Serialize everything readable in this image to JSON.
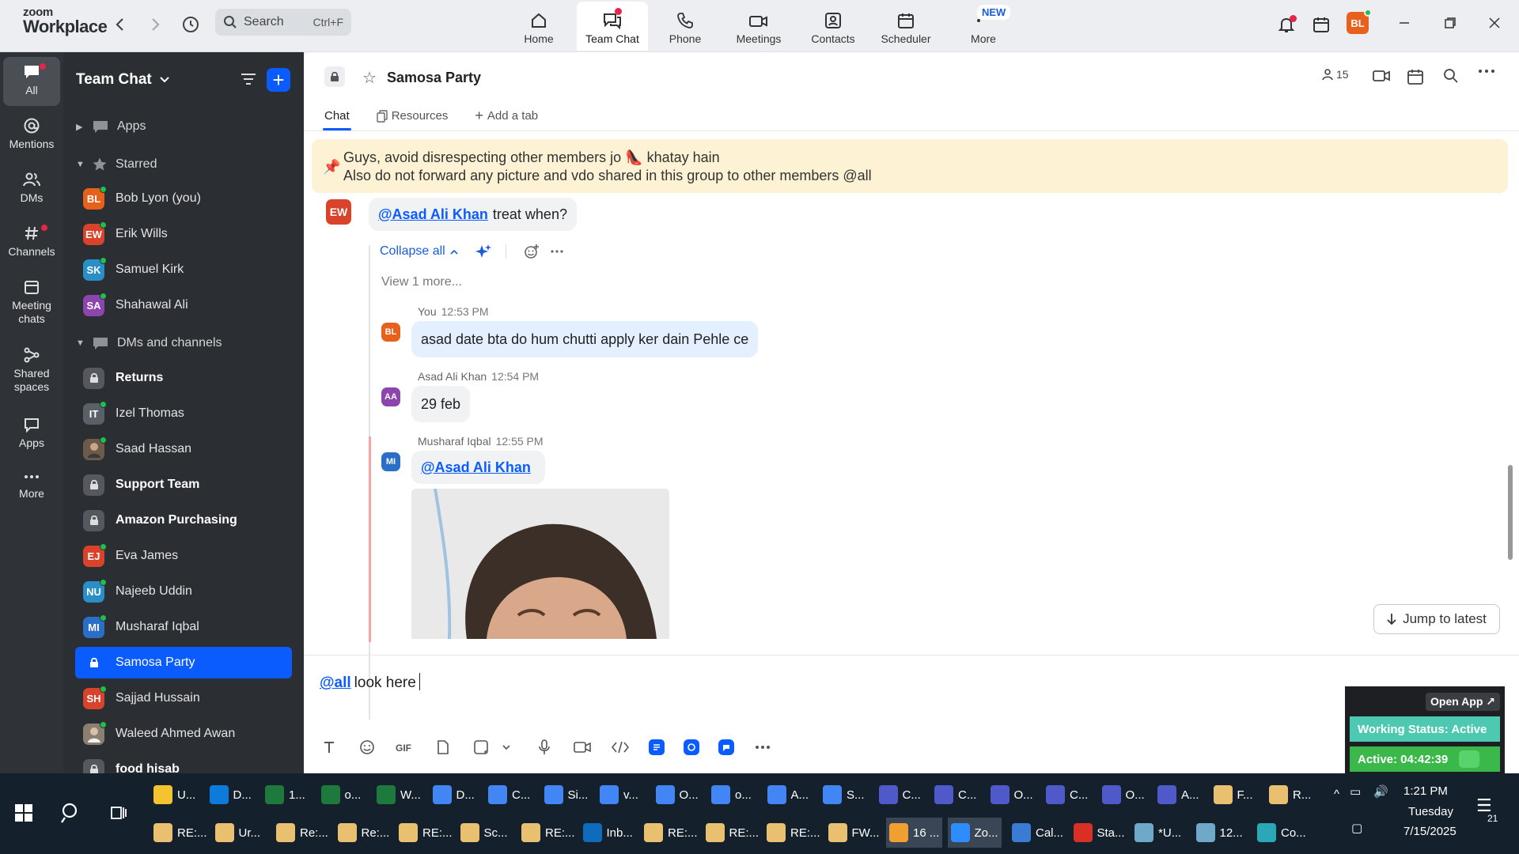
{
  "app": {
    "logo_line1": "zoom",
    "logo_line2": "Workplace",
    "search_placeholder": "Search",
    "search_shortcut": "Ctrl+F",
    "new_badge": "NEW",
    "user_initials": "BL",
    "accent": "#0b5cff"
  },
  "top_tabs": [
    {
      "label": "Home",
      "icon": "home-icon"
    },
    {
      "label": "Team Chat",
      "icon": "chat-icon",
      "active": true
    },
    {
      "label": "Phone",
      "icon": "phone-icon"
    },
    {
      "label": "Meetings",
      "icon": "video-icon"
    },
    {
      "label": "Contacts",
      "icon": "contacts-icon"
    },
    {
      "label": "Scheduler",
      "icon": "calendar-icon"
    },
    {
      "label": "More",
      "icon": "more-icon"
    }
  ],
  "rail": [
    {
      "label": "All",
      "icon": "chat-bubble-icon",
      "active": true
    },
    {
      "label": "Mentions",
      "icon": "at-icon"
    },
    {
      "label": "DMs",
      "icon": "people-icon"
    },
    {
      "label": "Channels",
      "icon": "hash-icon"
    },
    {
      "label": "Meeting chats",
      "icon": "calendar-icon"
    },
    {
      "label": "Shared spaces",
      "icon": "shared-icon"
    },
    {
      "label": "Apps",
      "icon": "apps-icon"
    },
    {
      "label": "More",
      "icon": "more-icon"
    }
  ],
  "sidebar": {
    "title": "Team Chat",
    "sections": {
      "apps": "Apps",
      "starred": "Starred",
      "dms": "DMs and channels"
    },
    "starred": [
      {
        "initials": "BL",
        "name": "Bob Lyon (you)",
        "color": "#e8611c"
      },
      {
        "initials": "EW",
        "name": "Erik Wills",
        "color": "#d9432b"
      },
      {
        "initials": "SK",
        "name": "Samuel Kirk",
        "color": "#2a8fc7"
      },
      {
        "initials": "SA",
        "name": "Shahawal Ali",
        "color": "#8e44ad"
      }
    ],
    "dms": [
      {
        "initials": "",
        "name": "Returns",
        "type": "lock",
        "bold": true
      },
      {
        "initials": "IT",
        "name": "Izel Thomas",
        "color": "#5a6068"
      },
      {
        "initials": "",
        "name": "Saad Hassan",
        "type": "photo",
        "color": "#6d5a4a"
      },
      {
        "initials": "",
        "name": "Support Team",
        "type": "lock",
        "bold": true
      },
      {
        "initials": "",
        "name": "Amazon Purchasing",
        "type": "lock",
        "bold": true
      },
      {
        "initials": "EJ",
        "name": "Eva James",
        "color": "#d9432b"
      },
      {
        "initials": "NU",
        "name": "Najeeb Uddin",
        "color": "#2a8fc7"
      },
      {
        "initials": "MI",
        "name": "Musharaf Iqbal",
        "color": "#2a6fc7"
      },
      {
        "initials": "",
        "name": "Samosa Party",
        "type": "lock",
        "selected": true
      },
      {
        "initials": "SH",
        "name": "Sajjad Hussain",
        "color": "#d9432b"
      },
      {
        "initials": "",
        "name": "Waleed Ahmed Awan",
        "type": "photo",
        "color": "#8a8070"
      },
      {
        "initials": "",
        "name": "food hisab",
        "type": "lock",
        "bold": true
      }
    ]
  },
  "channel": {
    "name": "Samosa Party",
    "member_count": "15",
    "tabs": [
      "Chat",
      "Resources",
      "Add a tab"
    ],
    "pinned_line1": "Guys, avoid disrespecting other members jo 👠 khatay hain",
    "pinned_line2": "Also do not forward any picture and vdo shared in this group to other members @all"
  },
  "messages": {
    "root": {
      "initials": "EW",
      "mention": "@Asad Ali Khan",
      "text": "treat when?"
    },
    "collapse_label": "Collapse all",
    "view_more": "View 1 more...",
    "replies": [
      {
        "author": "You",
        "time": "12:53 PM",
        "initials": "BL",
        "text": "asad date bta do hum chutti apply ker dain Pehle ce",
        "color": "#e8611c"
      },
      {
        "author": "Asad Ali Khan",
        "time": "12:54 PM",
        "initials": "AA",
        "text": "29 feb",
        "color": "#8e44ad"
      },
      {
        "author": "Musharaf Iqbal",
        "time": "12:55 PM",
        "initials": "MI",
        "text": "@Asad Ali Khan",
        "color": "#2a6fc7"
      }
    ],
    "jump_label": "Jump to latest"
  },
  "composer": {
    "mention": "@all",
    "text": "look here"
  },
  "widget": {
    "open_app": "Open App ↗",
    "status": "Working Status: Active",
    "active": "Active: 04:42:39"
  },
  "taskbar": {
    "row1": [
      "U...",
      "D...",
      "1...",
      "o...",
      "W...",
      "D...",
      "C...",
      "Si...",
      "v...",
      "O...",
      "o...",
      "A...",
      "S...",
      "C...",
      "C...",
      "O...",
      "C...",
      "O...",
      "A...",
      "F...",
      "R..."
    ],
    "row2": [
      "RE:...",
      "Ur...",
      "Re:...",
      "Re:...",
      "RE:...",
      "Sc...",
      "RE:...",
      "Inb...",
      "RE:...",
      "RE:...",
      "RE:...",
      "FW...",
      "16 ...",
      "Zo...",
      "Cal...",
      "Sta...",
      "*U...",
      "12...",
      "Co..."
    ],
    "time": "1:21 PM",
    "day": "Tuesday",
    "date": "7/15/2025",
    "notif_count": "21"
  }
}
